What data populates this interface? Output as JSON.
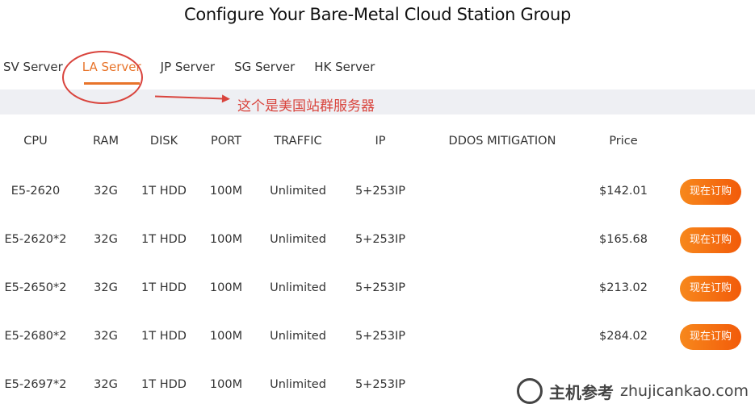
{
  "title": "Configure Your Bare-Metal Cloud Station Group",
  "tabs": [
    {
      "label": "SV Server"
    },
    {
      "label": "LA Server",
      "active": true
    },
    {
      "label": "JP Server"
    },
    {
      "label": "SG Server"
    },
    {
      "label": "HK Server"
    }
  ],
  "annotation": "这个是美国站群服务器",
  "accent": "#e8742a",
  "columns": [
    "CPU",
    "RAM",
    "DISK",
    "PORT",
    "TRAFFIC",
    "IP",
    "DDOS MITIGATION",
    "Price"
  ],
  "rows": [
    {
      "cpu": "E5-2620",
      "ram": "32G",
      "disk": "1T HDD",
      "port": "100M",
      "traffic": "Unlimited",
      "ip": "5+253IP",
      "ddos": "",
      "price": "$142.01",
      "order": "现在订购"
    },
    {
      "cpu": "E5-2620*2",
      "ram": "32G",
      "disk": "1T HDD",
      "port": "100M",
      "traffic": "Unlimited",
      "ip": "5+253IP",
      "ddos": "",
      "price": "$165.68",
      "order": "现在订购"
    },
    {
      "cpu": "E5-2650*2",
      "ram": "32G",
      "disk": "1T HDD",
      "port": "100M",
      "traffic": "Unlimited",
      "ip": "5+253IP",
      "ddos": "",
      "price": "$213.02",
      "order": "现在订购"
    },
    {
      "cpu": "E5-2680*2",
      "ram": "32G",
      "disk": "1T HDD",
      "port": "100M",
      "traffic": "Unlimited",
      "ip": "5+253IP",
      "ddos": "",
      "price": "$284.02",
      "order": "现在订购"
    },
    {
      "cpu": "E5-2697*2",
      "ram": "32G",
      "disk": "1T HDD",
      "port": "100M",
      "traffic": "Unlimited",
      "ip": "5+253IP",
      "ddos": "",
      "price": "",
      "order": ""
    }
  ],
  "watermark": {
    "cn": "主机参考",
    "url": "zhujicankao.com"
  }
}
